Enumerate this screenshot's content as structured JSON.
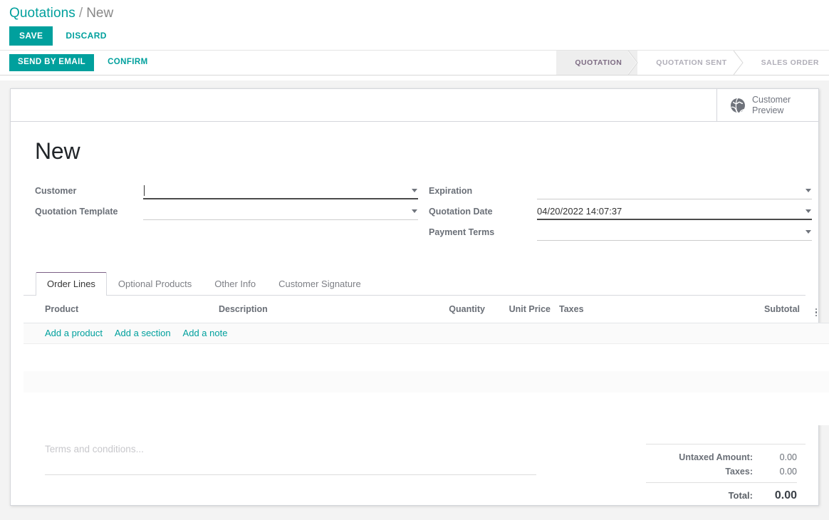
{
  "breadcrumb": {
    "root": "Quotations",
    "separator": "/",
    "current": "New"
  },
  "control_panel": {
    "save_label": "SAVE",
    "discard_label": "DISCARD"
  },
  "statusbar": {
    "buttons": [
      {
        "label": "SEND BY EMAIL",
        "style": "primary"
      },
      {
        "label": "CONFIRM",
        "style": "link"
      }
    ],
    "stages": [
      {
        "label": "QUOTATION",
        "active": true
      },
      {
        "label": "QUOTATION SENT",
        "active": false
      },
      {
        "label": "SALES ORDER",
        "active": false
      }
    ]
  },
  "button_box": {
    "customer_preview": {
      "icon": "globe-icon",
      "line1": "Customer",
      "line2": "Preview"
    }
  },
  "record": {
    "title": "New"
  },
  "form": {
    "left": [
      {
        "label": "Customer",
        "value": "",
        "state": "focused",
        "widget": "many2one"
      },
      {
        "label": "Quotation Template",
        "value": "",
        "state": "empty",
        "widget": "many2one"
      }
    ],
    "right": [
      {
        "label": "Expiration",
        "value": "",
        "state": "empty",
        "widget": "date"
      },
      {
        "label": "Quotation Date",
        "value": "04/20/2022 14:07:37",
        "state": "filled",
        "widget": "datetime"
      },
      {
        "label": "Payment Terms",
        "value": "",
        "state": "empty",
        "widget": "many2one"
      }
    ]
  },
  "notebook": {
    "tabs": [
      {
        "label": "Order Lines",
        "active": true
      },
      {
        "label": "Optional Products",
        "active": false
      },
      {
        "label": "Other Info",
        "active": false
      },
      {
        "label": "Customer Signature",
        "active": false
      }
    ]
  },
  "order_lines": {
    "columns": [
      "Product",
      "Description",
      "Quantity",
      "Unit Price",
      "Taxes",
      "Subtotal"
    ],
    "options_icon": "vertical-dots-icon",
    "rows": [],
    "add_links": [
      "Add a product",
      "Add a section",
      "Add a note"
    ]
  },
  "terms": {
    "placeholder": "Terms and conditions..."
  },
  "totals": [
    {
      "label": "Untaxed Amount:",
      "value": "0.00",
      "grand": false
    },
    {
      "label": "Taxes:",
      "value": "0.00",
      "grand": false
    },
    {
      "label": "Total:",
      "value": "0.00",
      "grand": true
    }
  ],
  "colors": {
    "accent_teal": "#00A09D",
    "stage_active_bg": "#eeeeee",
    "stage_active_text": "#7d6b83",
    "stage_inactive_text": "#b0aeb8",
    "label_gray": "#6a6f77",
    "page_bg": "#f3f3f3",
    "tab_active_top": "#7c5f86"
  }
}
